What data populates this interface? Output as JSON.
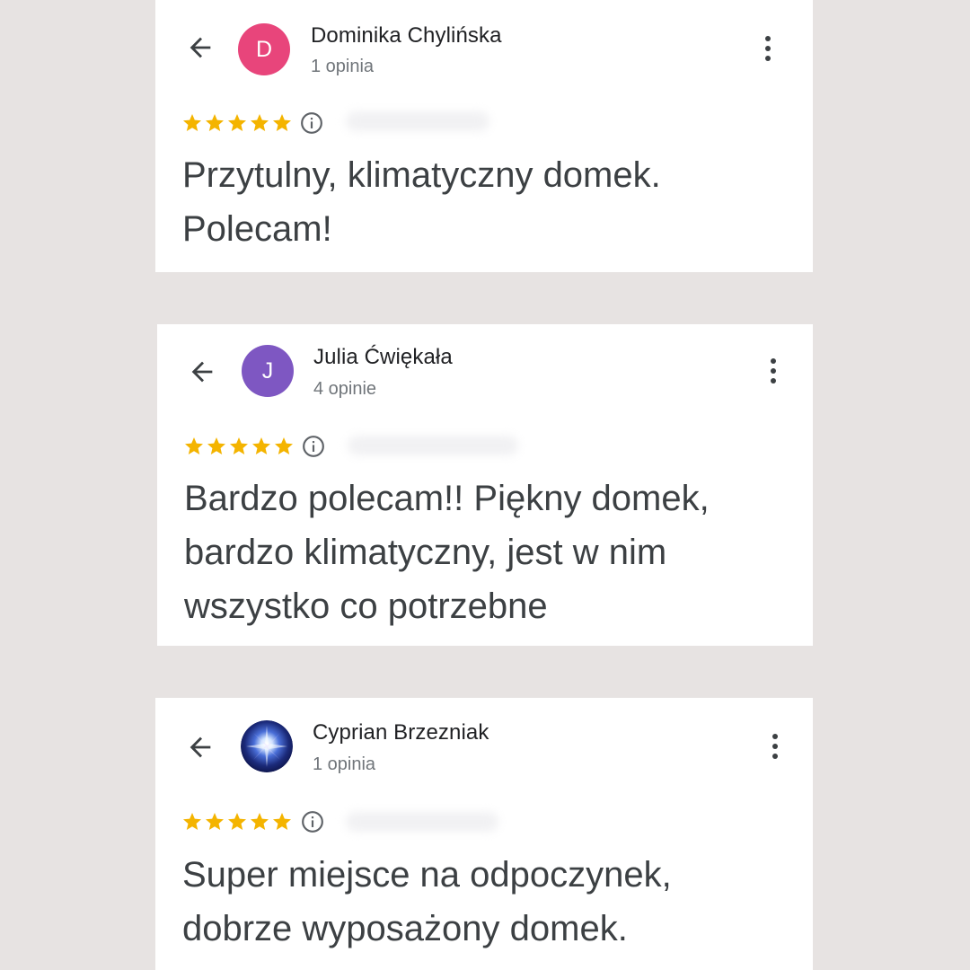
{
  "colors": {
    "background": "#e7e3e2",
    "card": "#ffffff",
    "star": "#f4b400",
    "avatar_d": "#e8457b",
    "avatar_j": "#7e57c2"
  },
  "reviews": [
    {
      "name": "Dominika Chylińska",
      "count": "1 opinia",
      "avatar_letter": "D",
      "rating": 5,
      "text_lines": [
        "Przytulny, klimatyczny domek.",
        "Polecam!"
      ]
    },
    {
      "name": "Julia Ćwiękała",
      "count": "4 opinie",
      "avatar_letter": "J",
      "rating": 5,
      "text_lines": [
        "Bardzo polecam!! Piękny domek,",
        "bardzo klimatyczny, jest w nim",
        "wszystko co potrzebne"
      ]
    },
    {
      "name": "Cyprian Brzezniak",
      "count": "1 opinia",
      "avatar_letter": "",
      "rating": 5,
      "text_lines": [
        "Super miejsce na odpoczynek,",
        "dobrze wyposażony domek."
      ]
    }
  ],
  "icons": {
    "back": "arrow-back-icon",
    "more": "more-vertical-icon",
    "info": "info-icon",
    "star": "star-icon"
  }
}
